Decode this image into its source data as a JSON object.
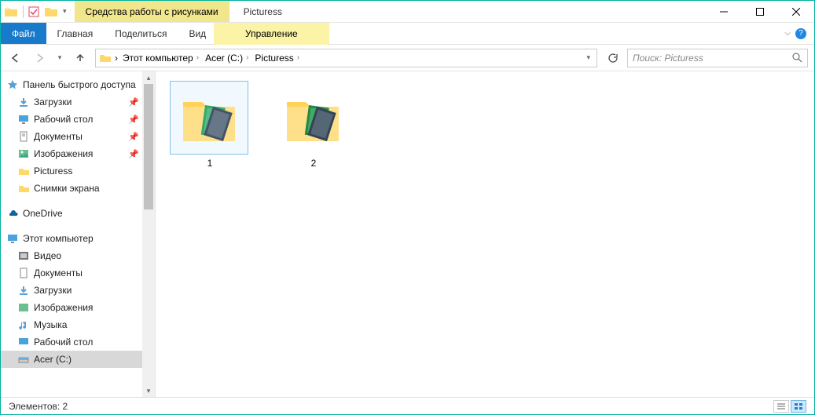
{
  "titlebar": {
    "context_tab": "Средства работы с рисунками",
    "title": "Picturess"
  },
  "ribbon": {
    "file": "Файл",
    "home": "Главная",
    "share": "Поделиться",
    "view": "Вид",
    "manage": "Управление"
  },
  "breadcrumb": {
    "root": "Этот компьютер",
    "drive": "Acer (C:)",
    "folder": "Picturess"
  },
  "search": {
    "placeholder": "Поиск: Picturess"
  },
  "sidebar": {
    "quick_access": "Панель быстрого доступа",
    "downloads": "Загрузки",
    "desktop": "Рабочий стол",
    "documents": "Документы",
    "pictures": "Изображения",
    "picturess": "Picturess",
    "screenshots": "Снимки экрана",
    "onedrive": "OneDrive",
    "this_pc": "Этот компьютер",
    "video": "Видео",
    "documents2": "Документы",
    "downloads2": "Загрузки",
    "pictures2": "Изображения",
    "music": "Музыка",
    "desktop2": "Рабочий стол",
    "drive": "Acer (C:)"
  },
  "items": {
    "i0": "1",
    "i1": "2"
  },
  "status": {
    "count": "Элементов: 2"
  }
}
